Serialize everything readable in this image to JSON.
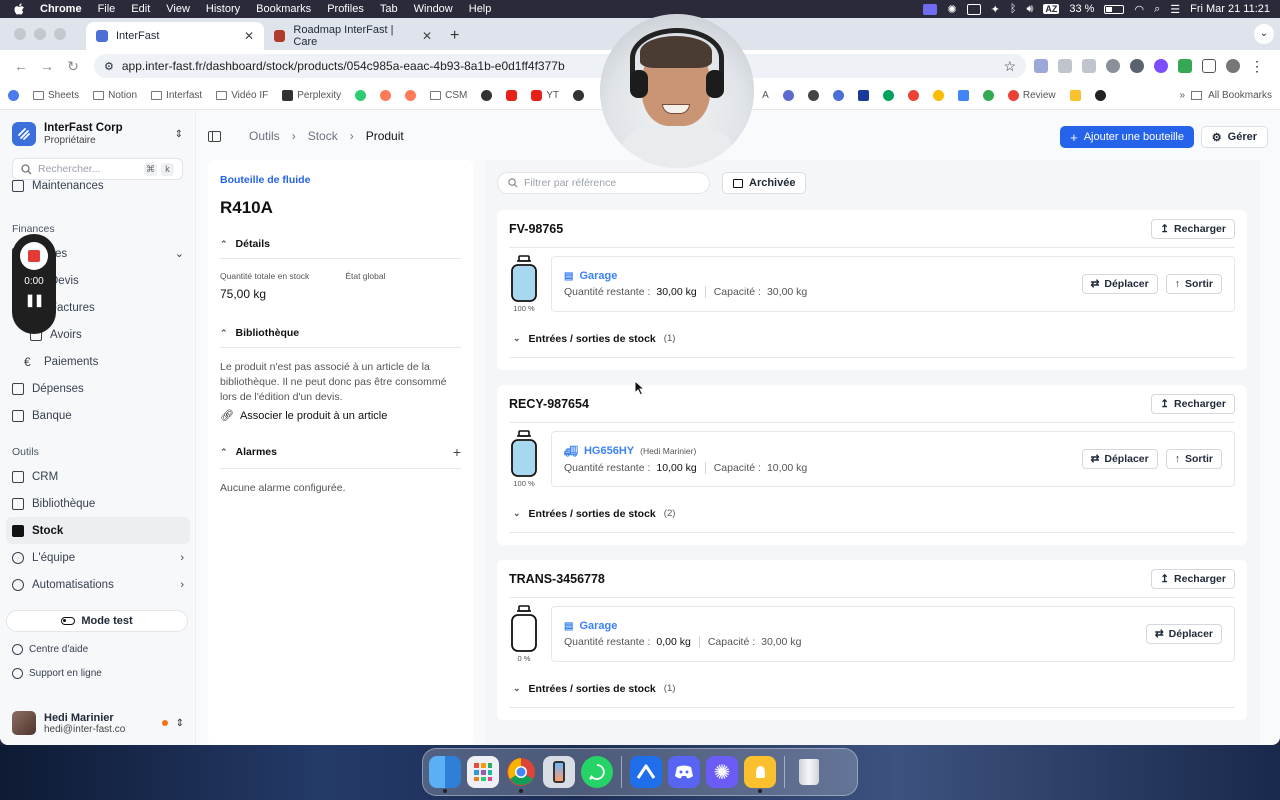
{
  "menubar": {
    "app": "Chrome",
    "items": [
      "File",
      "Edit",
      "View",
      "History",
      "Bookmarks",
      "Profiles",
      "Tab",
      "Window",
      "Help"
    ],
    "battery": "33 %",
    "input": "AZ",
    "datetime": "Fri Mar 21  11:21"
  },
  "browser": {
    "tabs": [
      {
        "title": "InterFast"
      },
      {
        "title": "Roadmap InterFast | Care"
      }
    ],
    "url": "app.inter-fast.fr/dashboard/stock/products/054c985a-eaac-4b93-8a1b-e0d1ff4f377b",
    "bookmarks": [
      "Sheets",
      "Notion",
      "Interfast",
      "Vidéo IF",
      "Perplexity",
      "CSM",
      "YT",
      "A",
      "Review"
    ],
    "all_bookmarks": "All Bookmarks"
  },
  "sidebar": {
    "org_name": "InterFast Corp",
    "org_role": "Propriétaire",
    "search_placeholder": "Rechercher...",
    "kbd1": "⌘",
    "kbd2": "k",
    "item_maintenances": "Maintenances",
    "section_finances": "Finances",
    "item_ventes": "Ventes",
    "item_devis": "Devis",
    "item_factures": "Factures",
    "item_avoirs": "Avoirs",
    "item_paiements": "Paiements",
    "item_depenses": "Dépenses",
    "item_banque": "Banque",
    "section_outils": "Outils",
    "item_crm": "CRM",
    "item_bibliotheque": "Bibliothèque",
    "item_stock": "Stock",
    "item_equipe": "L'équipe",
    "item_automatisations": "Automatisations",
    "mode_test": "Mode test",
    "help_center": "Centre d'aide",
    "support": "Support en ligne",
    "user_name": "Hedi Marinier",
    "user_email": "hedi@inter-fast.co"
  },
  "recorder": {
    "time": "0:00"
  },
  "topbar": {
    "crumb_1": "Outils",
    "crumb_2": "Stock",
    "crumb_3": "Produit",
    "add_button": "Ajouter une bouteille",
    "manage_button": "Gérer"
  },
  "product": {
    "type": "Bouteille de fluide",
    "name": "R410A",
    "details_title": "Détails",
    "qty_label": "Quantité totale en stock",
    "qty_value": "75,00 kg",
    "state_label": "État global",
    "library_title": "Bibliothèque",
    "library_text": "Le produit n'est pas associé à un article de la bibliothèque. Il ne peut donc pas être consommé lors de l'édition d'un devis.",
    "library_link": "Associer le produit à un article",
    "alarms_title": "Alarmes",
    "alarms_empty": "Aucune alarme configurée."
  },
  "stock": {
    "filter_placeholder": "Filtrer par référence",
    "archived_button": "Archivée",
    "recharge_label": "Recharger",
    "move_label": "Déplacer",
    "exit_label": "Sortir",
    "qty_label": "Quantité restante :",
    "cap_label": "Capacité :",
    "movements_label": "Entrées / sorties de stock",
    "bottles": [
      {
        "ref": "FV-98765",
        "location": "Garage",
        "location_sub": "",
        "remaining": "30,00 kg",
        "capacity": "30,00 kg",
        "fill_pct": 100,
        "fill_label": "100 %",
        "movements": "(1)"
      },
      {
        "ref": "RECY-987654",
        "location": "HG656HY",
        "location_sub": "(Hedi Marinier)",
        "remaining": "10,00 kg",
        "capacity": "10,00 kg",
        "fill_pct": 100,
        "fill_label": "100 %",
        "movements": "(2)"
      },
      {
        "ref": "TRANS-3456778",
        "location": "Garage",
        "location_sub": "",
        "remaining": "0,00 kg",
        "capacity": "30,00 kg",
        "fill_pct": 0,
        "fill_label": "0 %",
        "movements": "(1)"
      }
    ]
  },
  "colors": {
    "accent": "#2563eb",
    "bottle_fill": "#a8d8f0",
    "record": "#e53935"
  }
}
